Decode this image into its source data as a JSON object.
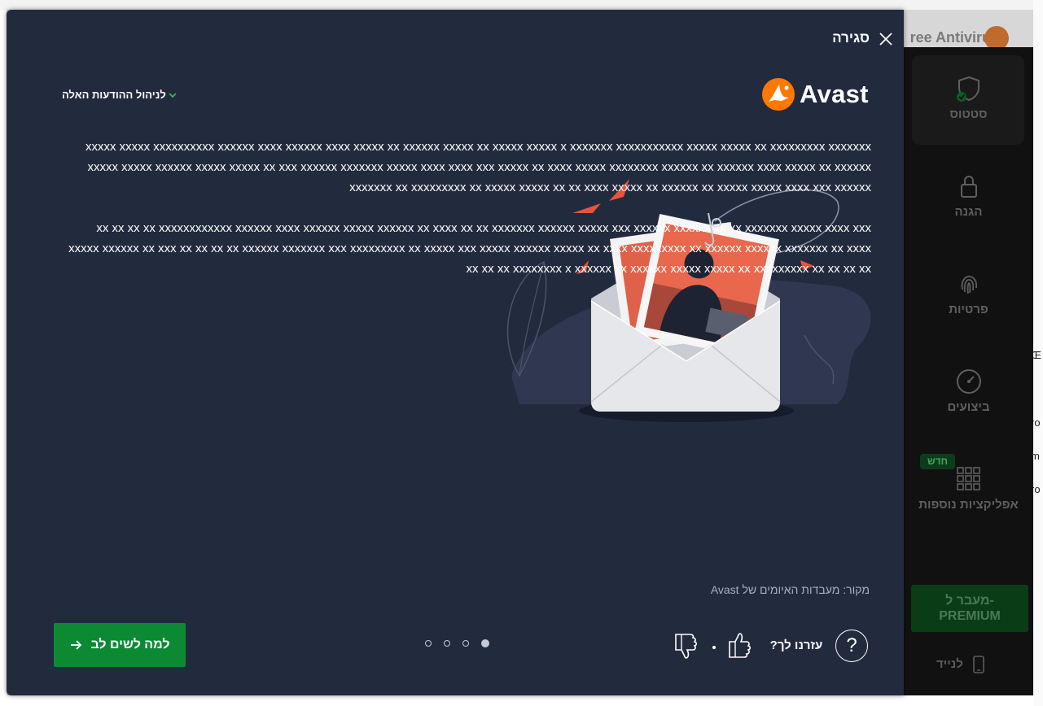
{
  "background_app": {
    "title": "ree Antivirus",
    "nav": [
      {
        "label": "סטטוס",
        "icon": "shield-check-icon"
      },
      {
        "label": "הגנה",
        "icon": "lock-icon"
      },
      {
        "label": "פרטיות",
        "icon": "fingerprint-icon"
      },
      {
        "label": "ביצועים",
        "icon": "speedometer-icon"
      },
      {
        "label": "אפליקציות נוספות",
        "icon": "apps-grid-icon"
      }
    ],
    "new_badge": "חדש",
    "premium_line1": "מעבר ל-",
    "premium_line2": "PREMIUM",
    "mobile_label": "לנייד",
    "edge_texts": [
      "Œ",
      "ro",
      "m",
      "ro"
    ]
  },
  "modal": {
    "close_label": "סגירה",
    "manage_notifications": "לניהול ההודעות האלה",
    "brand": "Avast",
    "paragraph1": "xxxxx xxxxx xxxxxxxxxx xxxxxx xxxx xxxxxx xxxx xxxxx xx xxxxxx xxxxx xx xxxxx xxxxx x xxxxxxx xxxxxxxxxxx xxxxx xxxxx xx xxxxxxxxx xxxxxxx xxxxx xxxxx xxxxxx xxxxx xxxxx xx xxx xxxxxx xxxxxxx xxxxx xxxx xxxx xxx xxxxx xx xxxx xxxxx xxxxxxxx xxxxxx xx xxxxxx xxxx xxxxx xx xxxxxx xxxxxxx xx xxxxxxxxx xx xxxxx xxxxx xx xx xxxx xxxxx xx xxxxxx xx xxxxx xxxxx xxxx xxx xxxxxx",
    "paragraph2": "xx xx xx xx xxxxxxxxxxxx xxxxxx xxxx xxxxxx xxxxx xxxxxx xx xxxx xx xx xxxxxxx xxxxxx xxxxx xxx xxxxxx xxxxxx xx xx xxxxxxx xxxxx xxxx xxx xxxxx xxxxxx xx xxx xx xx xx xx xxxxxx xxxxxxx xxx xxxxxxxxx xx xxxxx xxx xxxxx xxxxxx xxxxx xx xxxx xxxxxxxxx xx xxxxxx xxxxxx xxxxxxx xx xxxx xx xx xx xxxxxxxx x xxxxxx xx xxxxxx xxxxx xxxxx xx xxxxxxxxx xx xx xx xx",
    "source": "מקור: מעבדות האיומים של Avast",
    "cta_label": "למה לשים לב",
    "feedback_question": "עזרנו לך?",
    "help_symbol": "?",
    "pager": {
      "total": 4,
      "active_index": 3
    }
  },
  "colors": {
    "modal_bg": "#222a3e",
    "cta_green": "#0b8a33",
    "brand_orange": "#ff7800",
    "phishing_red": "#e8533a"
  }
}
